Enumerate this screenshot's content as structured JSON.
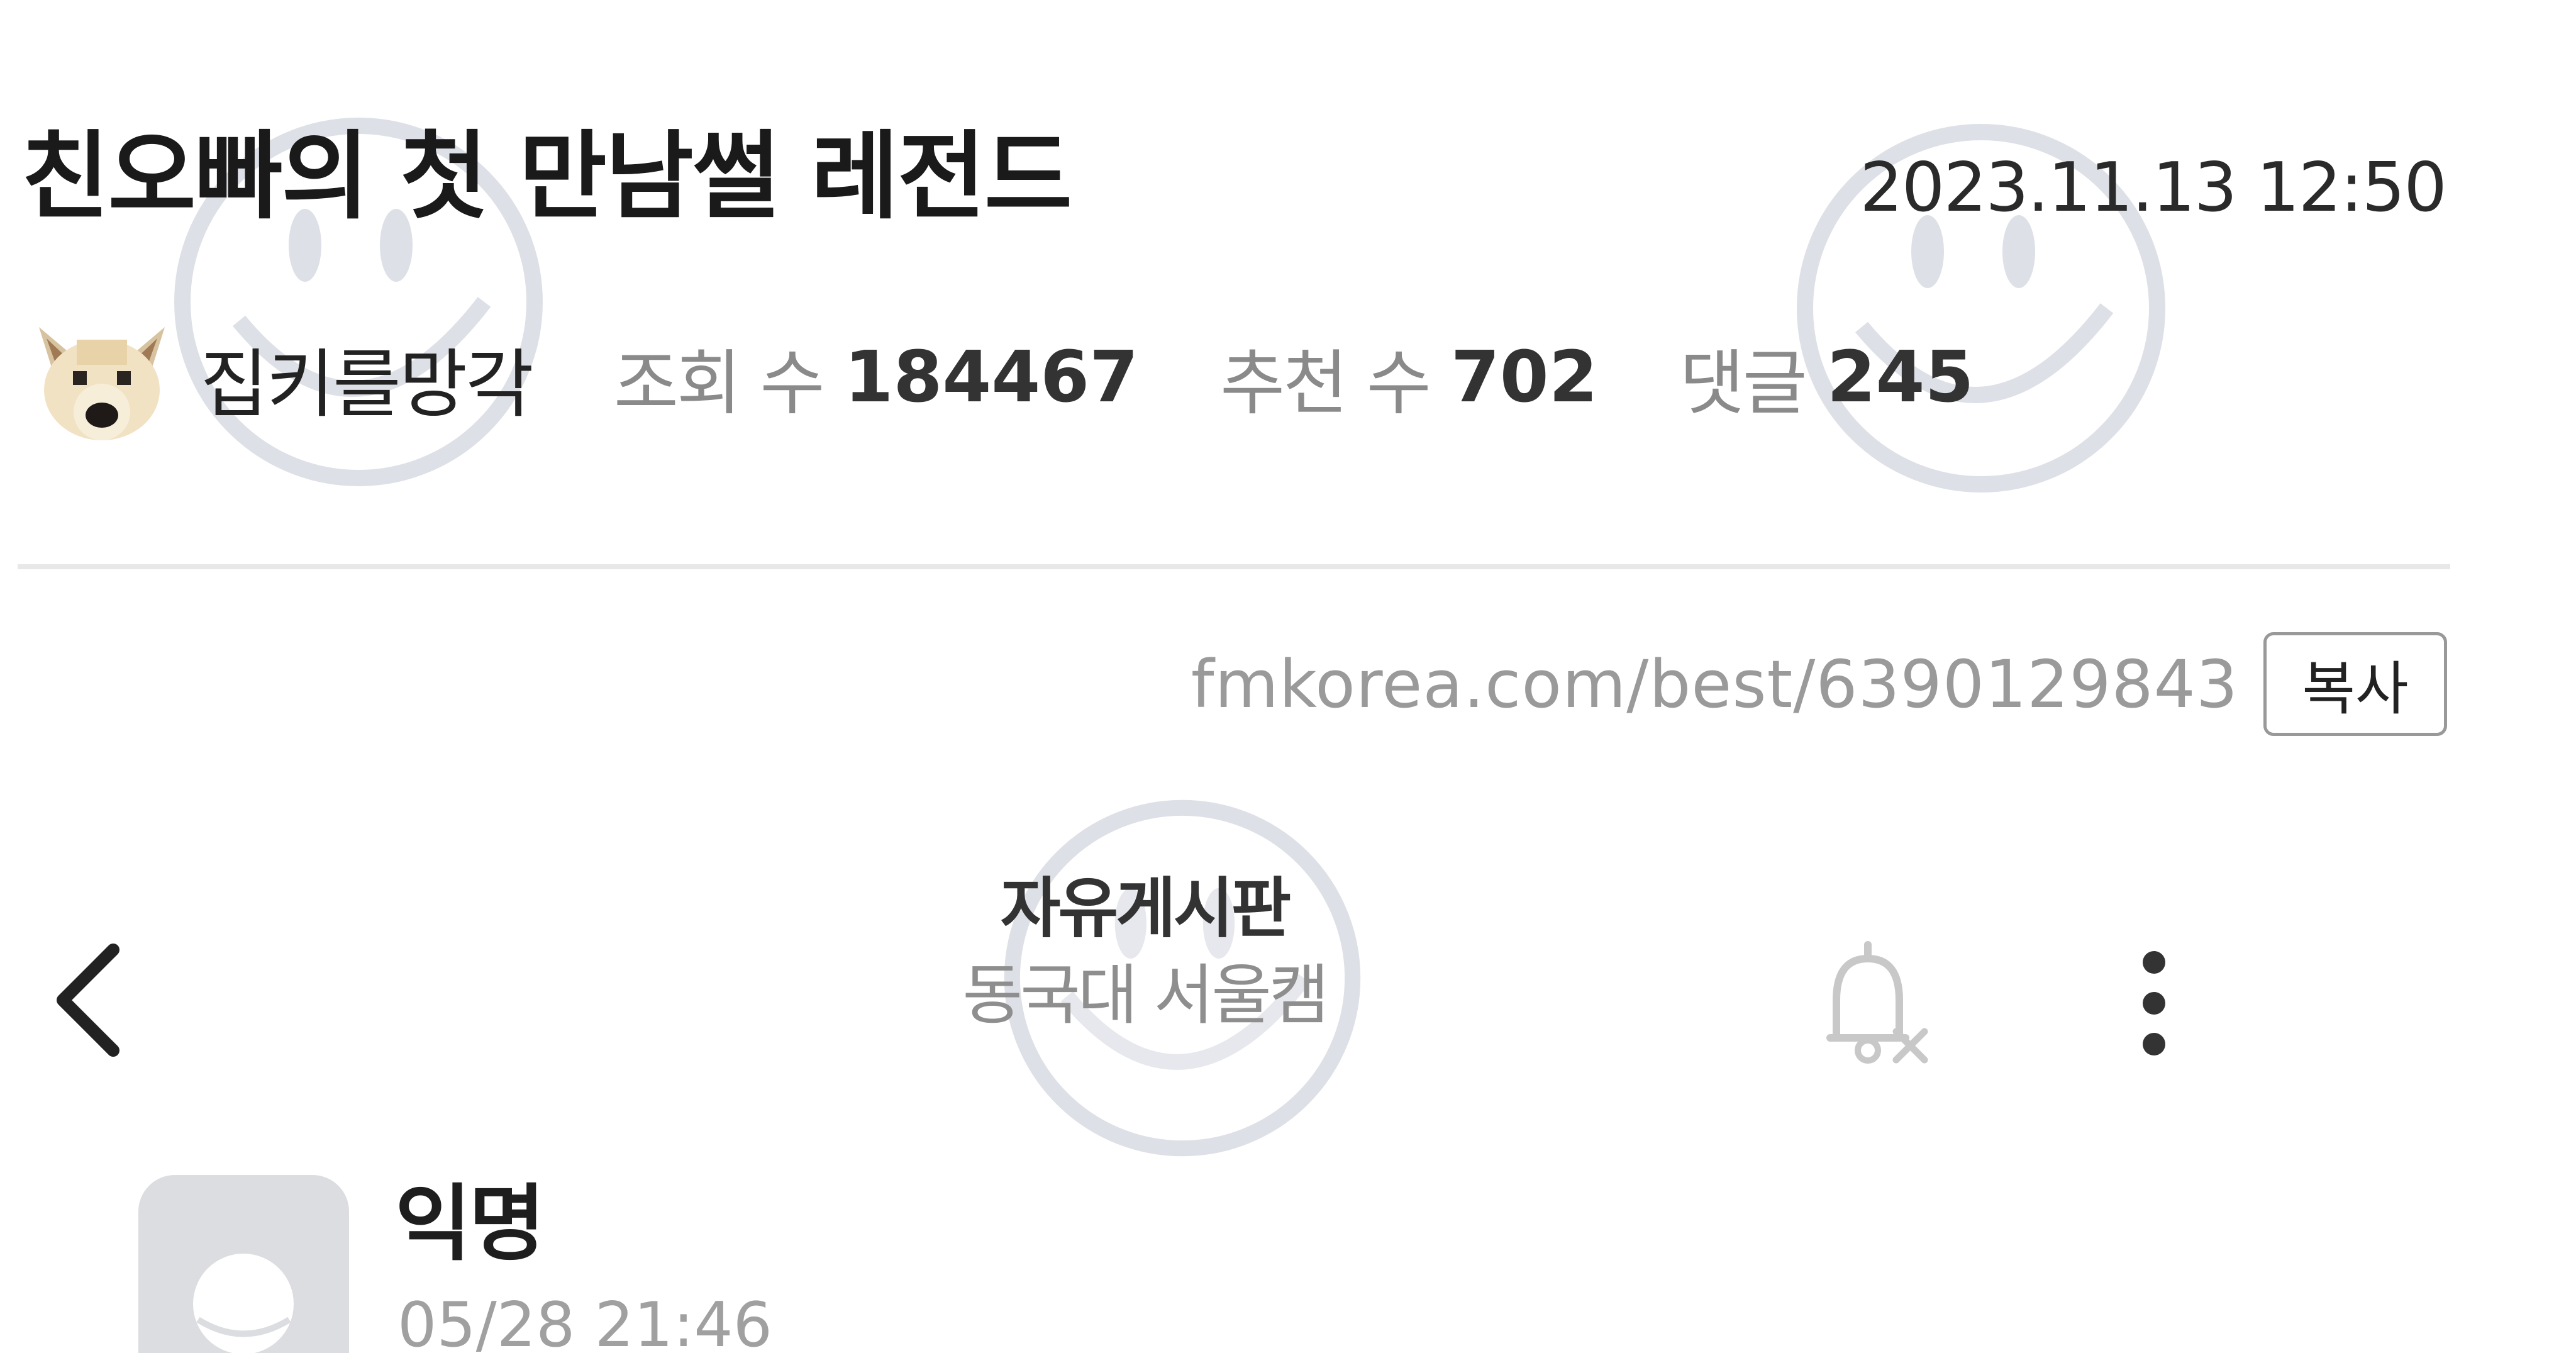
{
  "post": {
    "title": "친오빠의 첫 만남썰 레전드",
    "date": "2023.11.13 12:50",
    "author": "집키를망각",
    "views_label": "조회 수",
    "views": "184467",
    "recommend_label": "추천 수",
    "recommend": "702",
    "comments_label": "댓글",
    "comments": "245"
  },
  "link": {
    "url": "fmkorea.com/best/6390129843",
    "copy_label": "복사"
  },
  "embedded_app": {
    "board_name": "자유게시판",
    "board_sub": "동국대 서울캠",
    "icons": {
      "back": "chevron-left-icon",
      "bell": "bell-off-icon",
      "more": "more-vertical-icon"
    },
    "comment": {
      "author": "익명",
      "time": "05/28 21:46"
    }
  },
  "colors": {
    "watermark": "#d9dce3",
    "divider": "#e8e8e8",
    "meta_label": "#8a8a8a"
  }
}
